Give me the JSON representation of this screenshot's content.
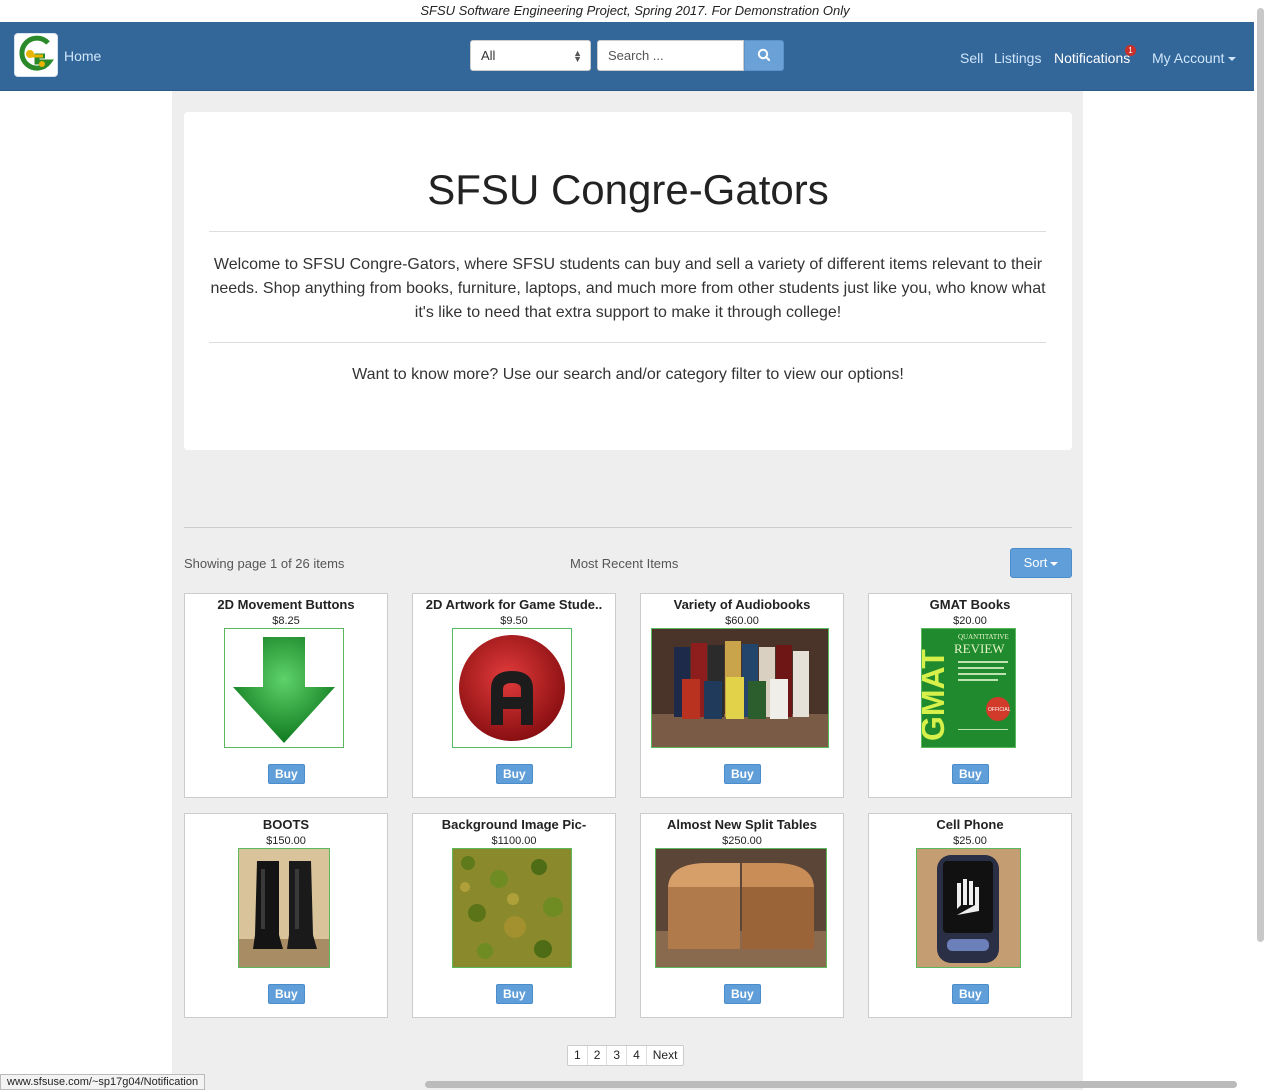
{
  "banner": "SFSU Software Engineering Project, Spring 2017. For Demonstration Only",
  "nav": {
    "home": "Home",
    "category": "All",
    "search_placeholder": "Search ...",
    "sell": "Sell",
    "listings": "Listings",
    "notifications": "Notifications",
    "notification_count": "1",
    "account": "My Account"
  },
  "jumbotron": {
    "title": "SFSU Congre-Gators",
    "welcome": "Welcome to SFSU Congre-Gators, where SFSU students can buy and sell a variety of different items relevant to their needs. Shop anything from books, furniture, laptops, and much more from other students just like you, who know what it's like to need that extra support to make it through college!",
    "more": "Want to know more? Use our search and/or category filter to view our options!"
  },
  "listing_header": {
    "showing": "Showing page 1 of 26 items",
    "section": "Most Recent Items",
    "sort": "Sort"
  },
  "items": [
    {
      "title": "2D Movement Buttons",
      "price": "$8.25",
      "buy": "Buy",
      "image": "green-down-arrow-icon"
    },
    {
      "title": "2D Artwork for Game Stude..",
      "price": "$9.50",
      "buy": "Buy",
      "image": "red-circle-a-logo"
    },
    {
      "title": "Variety of Audiobooks",
      "price": "$60.00",
      "buy": "Buy",
      "image": "audiobooks-photo"
    },
    {
      "title": "GMAT Books",
      "price": "$20.00",
      "buy": "Buy",
      "image": "gmat-book-cover"
    },
    {
      "title": "BOOTS",
      "price": "$150.00",
      "buy": "Buy",
      "image": "black-boots-photo"
    },
    {
      "title": "Background Image Pic-",
      "price": "$1100.00",
      "buy": "Buy",
      "image": "grass-texture"
    },
    {
      "title": "Almost New Split Tables",
      "price": "$250.00",
      "buy": "Buy",
      "image": "wooden-tables-photo"
    },
    {
      "title": "Cell Phone",
      "price": "$25.00",
      "buy": "Buy",
      "image": "lg-phone-photo"
    }
  ],
  "gmat_cover": {
    "brand": "GMAT",
    "line1": "QUANTITATIVE",
    "line2": "REVIEW",
    "badge": "OFFICIAL"
  },
  "pagination": [
    "1",
    "2",
    "3",
    "4",
    "Next"
  ],
  "status_url": "www.sfsuse.com/~sp17g04/Notification",
  "colors": {
    "navbar": "#336699",
    "primary_button": "#5f9ed8",
    "image_border": "#5cb85c",
    "badge": "#c9302c"
  }
}
